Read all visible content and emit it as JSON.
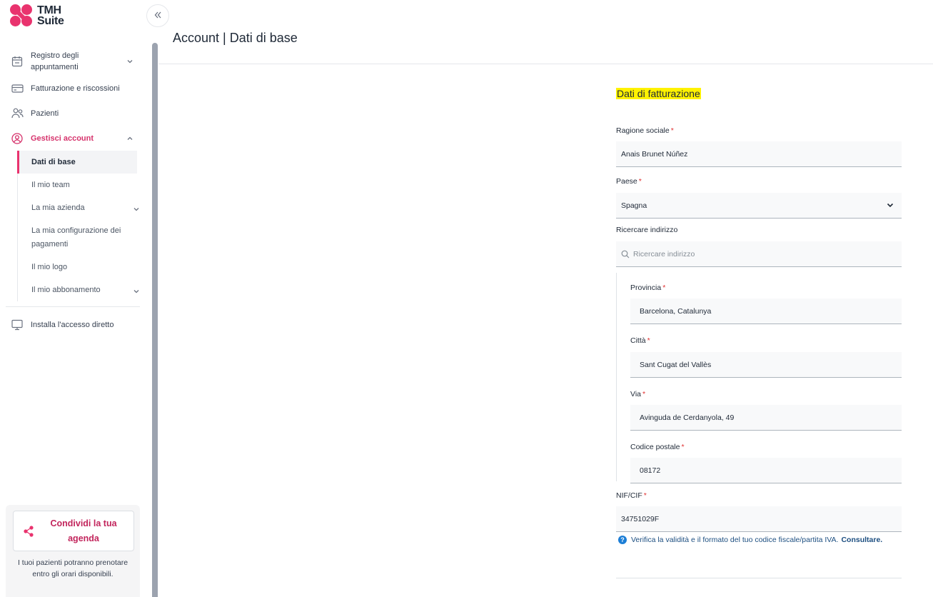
{
  "app": {
    "logo_line1": "TMH",
    "logo_line2": "Suite",
    "brand_color": "#e9336e"
  },
  "sidebar": {
    "items": [
      {
        "label": "Registro degli appuntamenti",
        "icon": "calendar-icon"
      },
      {
        "label": "Fatturazione e riscossioni",
        "icon": "credit-card-icon"
      },
      {
        "label": "Pazienti",
        "icon": "users-icon"
      },
      {
        "label": "Gestisci account",
        "icon": "user-circle-icon"
      }
    ],
    "subitems": [
      {
        "label": "Dati di base"
      },
      {
        "label": "Il mio team"
      },
      {
        "label": "La mia azienda"
      },
      {
        "label": "La mia configurazione dei pagamenti"
      },
      {
        "label": "Il mio logo"
      },
      {
        "label": "Il mio abbonamento"
      }
    ],
    "install": {
      "label": "Installa l'accesso diretto",
      "icon": "monitor-icon"
    },
    "share": {
      "button_label": "Condividi la tua agenda",
      "description": "I tuoi pazienti potranno prenotare entro gli orari disponibili."
    }
  },
  "header": {
    "title": "Account | Dati di base"
  },
  "form": {
    "section_title": "Dati di fatturazione",
    "ragione_sociale": {
      "label": "Ragione sociale",
      "value": "Anais Brunet Núñez"
    },
    "paese": {
      "label": "Paese",
      "value": "Spagna"
    },
    "ricerca": {
      "label": "Ricercare indirizzo",
      "placeholder": "Ricercare indirizzo"
    },
    "provincia": {
      "label": "Provincia",
      "value": "Barcelona, Catalunya"
    },
    "citta": {
      "label": "Città",
      "value": "Sant Cugat del Vallès"
    },
    "via": {
      "label": "Via",
      "value": "Avinguda de Cerdanyola, 49"
    },
    "codice_postale": {
      "label": "Codice postale",
      "value": "08172"
    },
    "nif": {
      "label": "NIF/CIF",
      "value": "34751029F"
    },
    "help_text": "Verifica la validità e il formato del tuo codice fiscale/partita IVA.",
    "help_link": "Consultare.",
    "required_mark": "*"
  }
}
